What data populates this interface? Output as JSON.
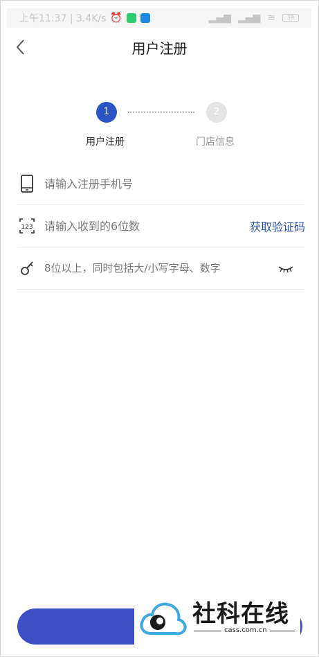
{
  "status_bar": {
    "left_text": "上午11:37 | 3.4K/s",
    "battery": "38"
  },
  "header": {
    "title": "用户注册"
  },
  "steps": [
    {
      "number": "1",
      "label": "用户注册"
    },
    {
      "number": "2",
      "label": "门店信息"
    }
  ],
  "form": {
    "phone_placeholder": "请输入注册手机号",
    "code_placeholder": "请输入收到的6位数",
    "get_code_label": "获取验证码",
    "password_placeholder": "8位以上，同时包括大/小写字母、数字"
  },
  "watermark": {
    "title": "社科在线",
    "domain": "cass.com.cn"
  },
  "colors": {
    "accent": "#2a54c6",
    "button": "#3d4fc2",
    "link": "#2a54a8"
  }
}
